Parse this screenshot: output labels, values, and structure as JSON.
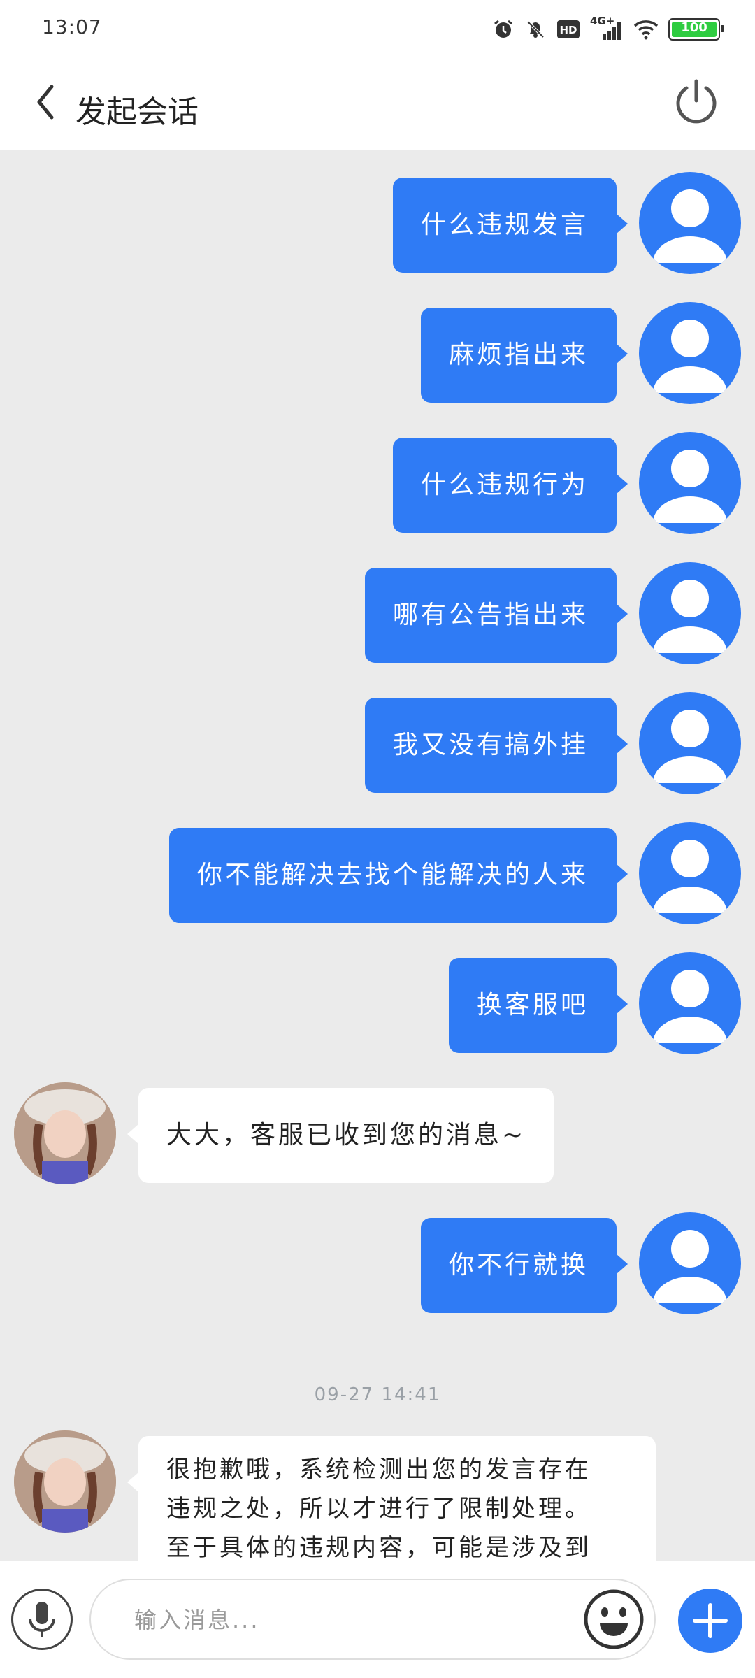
{
  "status_bar": {
    "time": "13:07",
    "network": "4G+",
    "battery": "100"
  },
  "header": {
    "back_icon": "chevron-left-icon",
    "title": "发起会话",
    "power_icon": "power-icon"
  },
  "colors": {
    "accent": "#2f7bf5",
    "chat_bg": "#ebebeb",
    "bubble_in": "#ffffff"
  },
  "messages": [
    {
      "from": "user",
      "text": "什么违规发言"
    },
    {
      "from": "user",
      "text": "麻烦指出来"
    },
    {
      "from": "user",
      "text": "什么违规行为"
    },
    {
      "from": "user",
      "text": "哪有公告指出来"
    },
    {
      "from": "user",
      "text": "我又没有搞外挂"
    },
    {
      "from": "user",
      "text": "你不能解决去找个能解决的人来"
    },
    {
      "from": "user",
      "text": "换客服吧"
    },
    {
      "from": "agent",
      "text": "大大，客服已收到您的消息~"
    },
    {
      "from": "user",
      "text": "你不行就换"
    },
    {
      "timestamp": "09-27 14:41"
    },
    {
      "from": "agent",
      "lines": [
        "很抱歉哦，系统检测出您的发言存在",
        "违规之处，所以才进行了限制处理。",
        "至于具体的违规内容，可能是涉及到"
      ]
    }
  ],
  "input": {
    "placeholder": "输入消息..."
  }
}
